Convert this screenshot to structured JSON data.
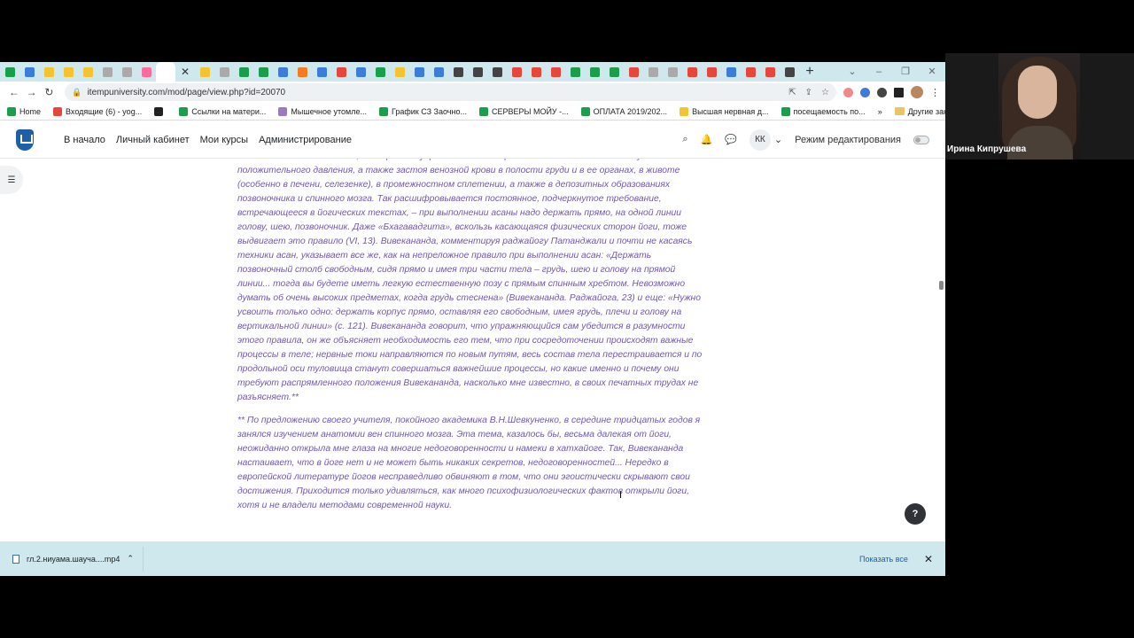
{
  "browser": {
    "tab_icon_colors": [
      "#1a9e4b",
      "#3b7dd8",
      "#f4c430",
      "#f4c430",
      "#f4c430",
      "#aaaaaa",
      "#aaaaaa",
      "#ff6b9d",
      "#ffffff",
      "#f4c430",
      "#aaaaaa",
      "#1a9e4b",
      "#1a9e4b",
      "#3b7dd8",
      "#f47b20",
      "#3b7dd8",
      "#e8453c",
      "#3b7dd8",
      "#1a9e4b",
      "#f4c430",
      "#3b7dd8",
      "#3b7dd8",
      "#444444",
      "#444444",
      "#444444",
      "#e8453c",
      "#e8453c",
      "#e8453c",
      "#1a9e4b",
      "#1a9e4b",
      "#1a9e4b",
      "#e8453c",
      "#aaaaaa",
      "#aaaaaa",
      "#e8453c",
      "#e8453c",
      "#3b7dd8",
      "#e8453c",
      "#e8453c",
      "#444444"
    ],
    "active_tab_index": 8,
    "new_tab_label": "+",
    "url": "itempuniversity.com/mod/page/view.php?id=20070",
    "bookmarks": [
      {
        "label": "Home",
        "color": "#1a9e4b"
      },
      {
        "label": "Входящие (6) - yog...",
        "color": "#e8453c"
      },
      {
        "label": "",
        "color": "#222222"
      },
      {
        "label": "Ссылки на матери...",
        "color": "#1a9e4b"
      },
      {
        "label": "Мышечное утомле...",
        "color": "#9a7bc0"
      },
      {
        "label": "График СЗ Заочно...",
        "color": "#1a9e4b"
      },
      {
        "label": "СЕРВЕРЫ МОЙУ -...",
        "color": "#1a9e4b"
      },
      {
        "label": "ОПЛАТА 2019/202...",
        "color": "#1a9e4b"
      },
      {
        "label": "Высшая нервная д...",
        "color": "#f4c430"
      },
      {
        "label": "посещаемость по...",
        "color": "#1a9e4b"
      }
    ],
    "bookmarks_more": "»",
    "other_bookmarks": "Другие закладки"
  },
  "moodle": {
    "nav": [
      "В начало",
      "Личный кабинет",
      "Мои курсы",
      "Администрирование"
    ],
    "user_initials": "КК",
    "edit_mode_label": "Режим редактирования",
    "help_label": "?"
  },
  "article": {
    "paragraph_1": "анатомии и заботе о теле, что при всех упражнениях с задержкой дыхания может возникнуть положительного давления, а также застоя венозной крови в полости груди и в ее органах, в животе (особенно в печени, селезенке), в промежностном сплетении, а также в депозитных образованиях позвоночника и спинного мозга. Так расшифровывается постоянное, подчеркнутое требование, встречающееся в йогических текстах, – при выполнении асаны надо держать прямо, на одной линии голову, шею, позвоночник. Даже «Бхагавадгита», вскользь касающаяся физических сторон йоги, тоже выдвигает это правило (VI, 13). Вивекананда, комментируя раджайогу Патанджали и почти не касаясь техники асан, указывает все же, как на непреложное правило при выполнении асан: «Держать позвоночный столб свободным, сидя прямо и имея три части тела – грудь, шею и голову на прямой линии... тогда вы будете иметь легкую естественную позу с прямым спинным хребтом. Невозможно думать об очень высоких предметах, когда грудь стеснена» (Вивекананда. Раджайога, 23) и еще: «Нужно усвоить только одно: держать корпус прямо, оставляя его свободным, имея грудь, плечи и голову на вертикальной линии» (с. 121). Вивекананда говорит, что упражняющийся сам убедится в разумности этого правила, он же объясняет необходимость его тем, что при сосредоточении происходят важные процессы в теле; нервные токи направляются по новым путям, весь состав тела перестраивается и по продольной оси туловища станут совершаться важнейшие процессы, но какие именно и почему они требуют распрямленного положения Вивекананда, насколько мне известно, в своих печатных трудах не разъясняет.**",
    "paragraph_2": "** По предложению своего учителя, покойного академика В.Н.Шевкуненко, в середине тридцатых годов я занялся изучением анатомии вен спинного мозга. Эта тема, казалось бы, весьма далекая от йоги, неожиданно открыла мне глаза на многие недоговоренности и намеки в хатхайоге. Так, Вивекананда настаивает, что в йоге нет и не может быть никаких секретов, недоговоренностей... Нередко в европейской литературе йогов несправедливо обвиняют в том, что они эгоистически скрывают свои достижения. Приходится только удивляться, как много психофизиологических фактов открыли йоги, хотя и не владели методами современной науки."
  },
  "download_bar": {
    "file_name": "гл.2.ниyама.шауча....mp4",
    "show_all": "Показать все",
    "close_label": "✕"
  },
  "participant": {
    "name": "Ирина Кипрушева"
  }
}
